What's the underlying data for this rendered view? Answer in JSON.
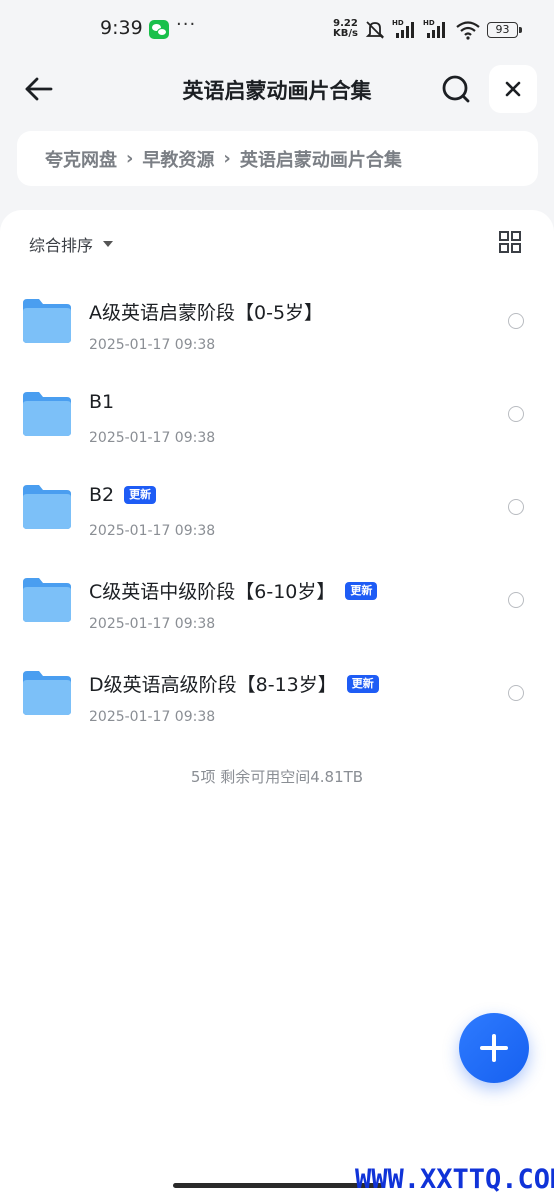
{
  "status_bar": {
    "time": "9:39",
    "net_speed_value": "9.22",
    "net_speed_unit": "KB/s",
    "battery": "93",
    "icons": [
      "wechat-icon",
      "more-dots-icon",
      "mute-icon",
      "signal-hd-icon",
      "signal-hd-icon",
      "wifi-icon",
      "battery-icon"
    ]
  },
  "header": {
    "title": "英语启蒙动画片合集",
    "icons": [
      "back-arrow-icon",
      "search-icon",
      "close-icon"
    ]
  },
  "breadcrumb": {
    "items": [
      "夸克网盘",
      "早教资源",
      "英语启蒙动画片合集"
    ],
    "separator": "›"
  },
  "toolbar": {
    "sort_label": "综合排序",
    "view_toggle_icon": "grid-view-icon"
  },
  "files": [
    {
      "name": "A级英语启蒙阶段【0-5岁】",
      "date": "2025-01-17 09:38",
      "badge": ""
    },
    {
      "name": "B1",
      "date": "2025-01-17 09:38",
      "badge": ""
    },
    {
      "name": "B2",
      "date": "2025-01-17 09:38",
      "badge": "更新"
    },
    {
      "name": "C级英语中级阶段【6-10岁】",
      "date": "2025-01-17 09:38",
      "badge": "更新"
    },
    {
      "name": "D级英语高级阶段【8-13岁】",
      "date": "2025-01-17 09:38",
      "badge": "更新"
    }
  ],
  "summary": "5项 剩余可用空间4.81TB",
  "fab_icon": "plus-icon",
  "watermark": "WWW.XXTTQ.COM",
  "colors": {
    "accent": "#1e5cf5",
    "folder": "#5aa9f2",
    "background": "#f4f5f7"
  }
}
